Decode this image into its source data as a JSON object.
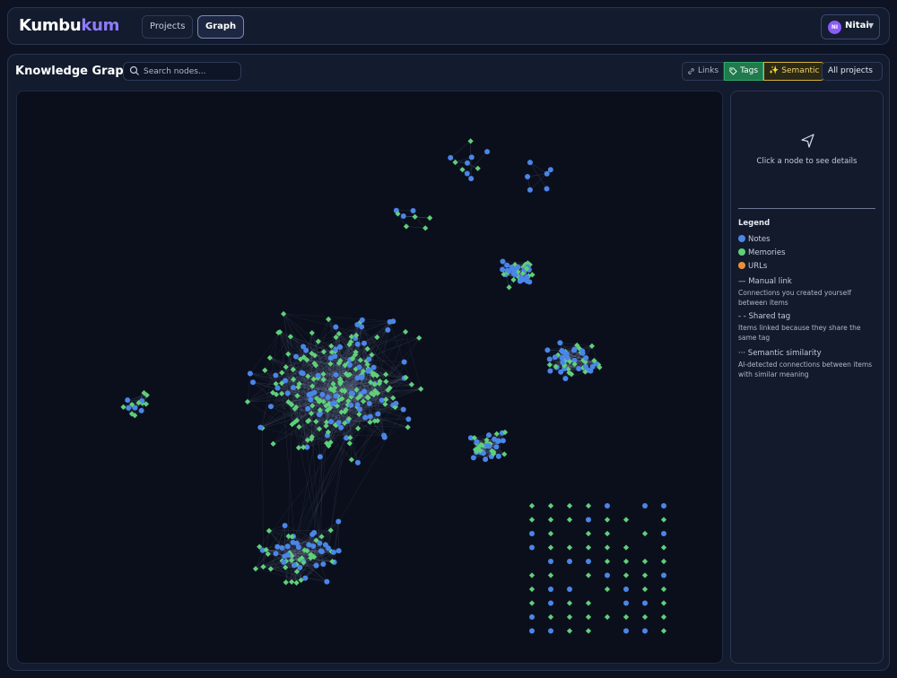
{
  "app": {
    "logo_part1": "Kumbu",
    "logo_part2": "kum",
    "nav": [
      {
        "label": "Projects",
        "active": false
      },
      {
        "label": "Graph",
        "active": true
      }
    ],
    "user": {
      "initials": "NI",
      "name": "Nitai"
    }
  },
  "page": {
    "title": "Knowledge Graph",
    "search_placeholder": "Search nodes...",
    "filters": {
      "links": "Links",
      "tags": "Tags",
      "semantic": "Semantic"
    },
    "project_select": "All projects"
  },
  "detail_panel": {
    "hint": "Click a node to see details",
    "legend": {
      "title": "Legend",
      "notes": "Notes",
      "memories": "Memories",
      "urls": "URLs",
      "manual_title": "— Manual link",
      "manual_desc": "Connections you created yourself between items",
      "shared_title": "- - Shared tag",
      "shared_desc": "Items linked because they share the same tag",
      "semantic_title": "··· Semantic similarity",
      "semantic_desc": "AI-detected connections between items with similar meaning"
    }
  },
  "colors": {
    "note": "#4a86e8",
    "memory": "#5fd07a",
    "url": "#e8913a",
    "edge": "#8a97b8",
    "accent": "#8f7bff"
  }
}
